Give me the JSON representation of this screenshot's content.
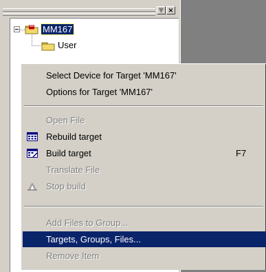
{
  "toolbar": {
    "dropdown_glyph": "▼",
    "close_glyph": "×"
  },
  "tree": {
    "expander_symbol": "−",
    "target_label": "MM167",
    "group_label": "User"
  },
  "menu": {
    "items": [
      {
        "label": "Select Device for Target 'MM167'",
        "enabled": true
      },
      {
        "label": "Options for Target 'MM167'",
        "enabled": true
      },
      {
        "label": "Open File",
        "enabled": false
      },
      {
        "label": "Rebuild target",
        "enabled": true,
        "icon": "rebuild-icon"
      },
      {
        "label": "Build target",
        "enabled": true,
        "icon": "build-icon",
        "shortcut": "F7"
      },
      {
        "label": "Translate File",
        "enabled": false
      },
      {
        "label": "Stop build",
        "enabled": false,
        "icon": "stop-build-icon"
      },
      {
        "label": "Add Files to Group...",
        "enabled": false
      },
      {
        "label": "Targets, Groups, Files...",
        "enabled": true,
        "selected": true
      },
      {
        "label": "Remove Item",
        "enabled": false
      }
    ]
  },
  "colors": {
    "selection": "#0a246a",
    "face": "#d4d0c8",
    "disabled_text": "#808080"
  }
}
